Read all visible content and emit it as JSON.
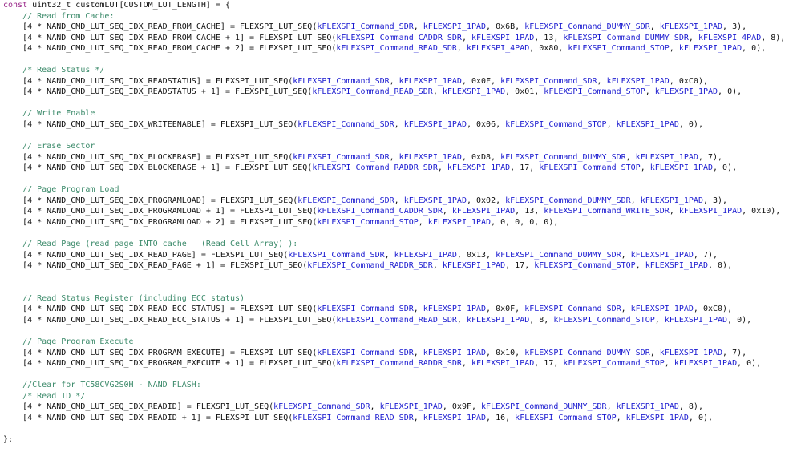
{
  "colors": {
    "keyword": "#9b2a8a",
    "comment": "#3b8a6a",
    "enum": "#1a1ad0",
    "text": "#111111"
  },
  "code": {
    "lines": [
      "const uint32_t customLUT[CUSTOM_LUT_LENGTH] = {",
      "    // Read from Cache:",
      "    [4 * NAND_CMD_LUT_SEQ_IDX_READ_FROM_CACHE] = FLEXSPI_LUT_SEQ(kFLEXSPI_Command_SDR, kFLEXSPI_1PAD, 0x6B, kFLEXSPI_Command_DUMMY_SDR, kFLEXSPI_1PAD, 3),",
      "    [4 * NAND_CMD_LUT_SEQ_IDX_READ_FROM_CACHE + 1] = FLEXSPI_LUT_SEQ(kFLEXSPI_Command_CADDR_SDR, kFLEXSPI_1PAD, 13, kFLEXSPI_Command_DUMMY_SDR, kFLEXSPI_4PAD, 8),",
      "    [4 * NAND_CMD_LUT_SEQ_IDX_READ_FROM_CACHE + 2] = FLEXSPI_LUT_SEQ(kFLEXSPI_Command_READ_SDR, kFLEXSPI_4PAD, 0x80, kFLEXSPI_Command_STOP, kFLEXSPI_1PAD, 0),",
      "",
      "    /* Read Status */",
      "    [4 * NAND_CMD_LUT_SEQ_IDX_READSTATUS] = FLEXSPI_LUT_SEQ(kFLEXSPI_Command_SDR, kFLEXSPI_1PAD, 0x0F, kFLEXSPI_Command_SDR, kFLEXSPI_1PAD, 0xC0),",
      "    [4 * NAND_CMD_LUT_SEQ_IDX_READSTATUS + 1] = FLEXSPI_LUT_SEQ(kFLEXSPI_Command_READ_SDR, kFLEXSPI_1PAD, 0x01, kFLEXSPI_Command_STOP, kFLEXSPI_1PAD, 0),",
      "",
      "    // Write Enable",
      "    [4 * NAND_CMD_LUT_SEQ_IDX_WRITEENABLE] = FLEXSPI_LUT_SEQ(kFLEXSPI_Command_SDR, kFLEXSPI_1PAD, 0x06, kFLEXSPI_Command_STOP, kFLEXSPI_1PAD, 0),",
      "",
      "    // Erase Sector",
      "    [4 * NAND_CMD_LUT_SEQ_IDX_BLOCKERASE] = FLEXSPI_LUT_SEQ(kFLEXSPI_Command_SDR, kFLEXSPI_1PAD, 0xD8, kFLEXSPI_Command_DUMMY_SDR, kFLEXSPI_1PAD, 7),",
      "    [4 * NAND_CMD_LUT_SEQ_IDX_BLOCKERASE + 1] = FLEXSPI_LUT_SEQ(kFLEXSPI_Command_RADDR_SDR, kFLEXSPI_1PAD, 17, kFLEXSPI_Command_STOP, kFLEXSPI_1PAD, 0),",
      "",
      "    // Page Program Load",
      "    [4 * NAND_CMD_LUT_SEQ_IDX_PROGRAMLOAD] = FLEXSPI_LUT_SEQ(kFLEXSPI_Command_SDR, kFLEXSPI_1PAD, 0x02, kFLEXSPI_Command_DUMMY_SDR, kFLEXSPI_1PAD, 3),",
      "    [4 * NAND_CMD_LUT_SEQ_IDX_PROGRAMLOAD + 1] = FLEXSPI_LUT_SEQ(kFLEXSPI_Command_CADDR_SDR, kFLEXSPI_1PAD, 13, kFLEXSPI_Command_WRITE_SDR, kFLEXSPI_1PAD, 0x10),",
      "    [4 * NAND_CMD_LUT_SEQ_IDX_PROGRAMLOAD + 2] = FLEXSPI_LUT_SEQ(kFLEXSPI_Command_STOP, kFLEXSPI_1PAD, 0, 0, 0, 0),",
      "",
      "    // Read Page (read page INTO cache   (Read Cell Array) ):",
      "    [4 * NAND_CMD_LUT_SEQ_IDX_READ_PAGE] = FLEXSPI_LUT_SEQ(kFLEXSPI_Command_SDR, kFLEXSPI_1PAD, 0x13, kFLEXSPI_Command_DUMMY_SDR, kFLEXSPI_1PAD, 7),",
      "    [4 * NAND_CMD_LUT_SEQ_IDX_READ_PAGE + 1] = FLEXSPI_LUT_SEQ(kFLEXSPI_Command_RADDR_SDR, kFLEXSPI_1PAD, 17, kFLEXSPI_Command_STOP, kFLEXSPI_1PAD, 0),",
      "",
      "",
      "    // Read Status Register (including ECC status)",
      "    [4 * NAND_CMD_LUT_SEQ_IDX_READ_ECC_STATUS] = FLEXSPI_LUT_SEQ(kFLEXSPI_Command_SDR, kFLEXSPI_1PAD, 0x0F, kFLEXSPI_Command_SDR, kFLEXSPI_1PAD, 0xC0),",
      "    [4 * NAND_CMD_LUT_SEQ_IDX_READ_ECC_STATUS + 1] = FLEXSPI_LUT_SEQ(kFLEXSPI_Command_READ_SDR, kFLEXSPI_1PAD, 8, kFLEXSPI_Command_STOP, kFLEXSPI_1PAD, 0),",
      "",
      "    // Page Program Execute",
      "    [4 * NAND_CMD_LUT_SEQ_IDX_PROGRAM_EXECUTE] = FLEXSPI_LUT_SEQ(kFLEXSPI_Command_SDR, kFLEXSPI_1PAD, 0x10, kFLEXSPI_Command_DUMMY_SDR, kFLEXSPI_1PAD, 7),",
      "    [4 * NAND_CMD_LUT_SEQ_IDX_PROGRAM_EXECUTE + 1] = FLEXSPI_LUT_SEQ(kFLEXSPI_Command_RADDR_SDR, kFLEXSPI_1PAD, 17, kFLEXSPI_Command_STOP, kFLEXSPI_1PAD, 0),",
      "",
      "    //Clear for TC58CVG2S0H - NAND FLASH:",
      "    /* Read ID */",
      "    [4 * NAND_CMD_LUT_SEQ_IDX_READID] = FLEXSPI_LUT_SEQ(kFLEXSPI_Command_SDR, kFLEXSPI_1PAD, 0x9F, kFLEXSPI_Command_DUMMY_SDR, kFLEXSPI_1PAD, 8),",
      "    [4 * NAND_CMD_LUT_SEQ_IDX_READID + 1] = FLEXSPI_LUT_SEQ(kFLEXSPI_Command_READ_SDR, kFLEXSPI_1PAD, 16, kFLEXSPI_Command_STOP, kFLEXSPI_1PAD, 0),",
      "",
      "};"
    ]
  }
}
